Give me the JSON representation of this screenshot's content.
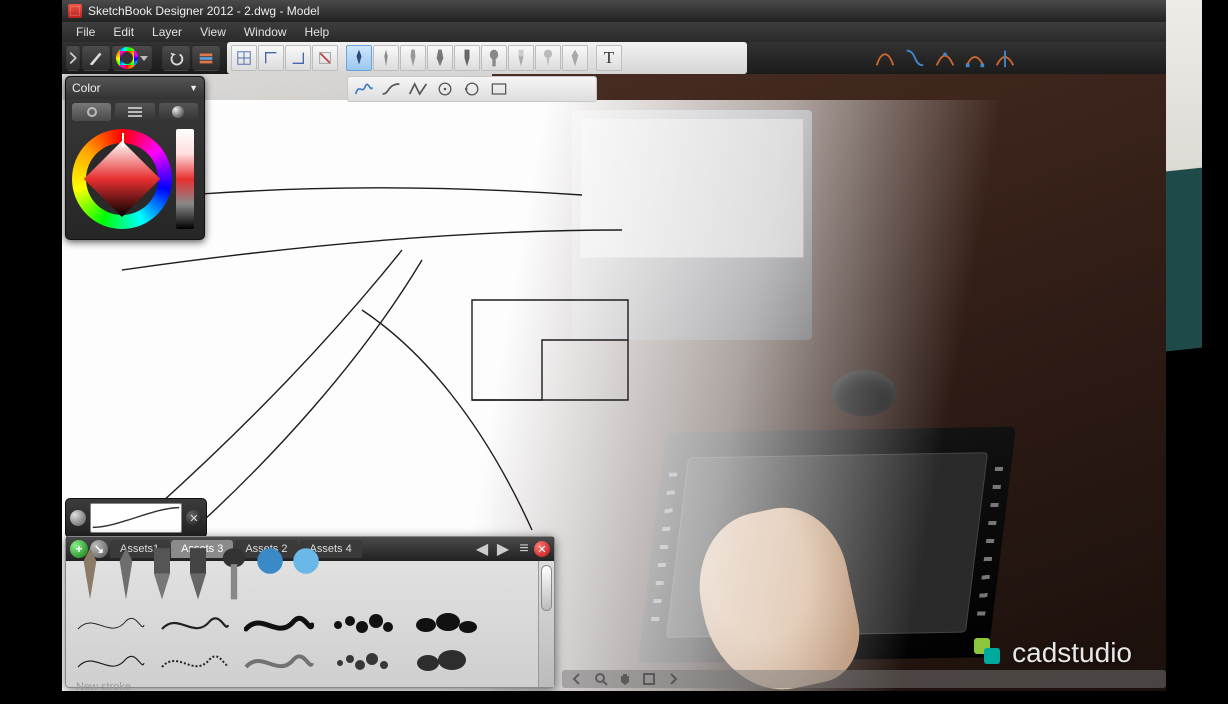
{
  "titlebar": {
    "title": "SketchBook Designer 2012 - 2.dwg - Model"
  },
  "menubar": {
    "items": [
      "File",
      "Edit",
      "Layer",
      "View",
      "Window",
      "Help"
    ]
  },
  "color_panel": {
    "title": "Color"
  },
  "toolbar1_icons": [
    "collapse-handle",
    "brush",
    "color-ring-dropdown",
    "",
    "undo",
    "redo-stripes",
    "",
    "snap-grid",
    "snap-perp",
    "snap-corner",
    "snap-off",
    "pen",
    "pen2",
    "marker",
    "marker2",
    "marker3",
    "airbrush",
    "pencil",
    "",
    "text",
    "",
    "curve-red",
    "curve-cyan",
    "curve-join",
    "curve-edit",
    "curve-split"
  ],
  "light_tools": [
    "pen-blue",
    "pen-thin",
    "pen-mid",
    "nib",
    "nib2",
    "chisel",
    "chisel2",
    "hilite",
    "round"
  ],
  "curve_shapes": [
    "freehand",
    "wave-s",
    "wave-n",
    "ellipse-center",
    "ellipse-3pt",
    "rect"
  ],
  "assets": {
    "tabs": [
      "Assets1",
      "Assets 3",
      "Assets 2",
      "Assets 4"
    ],
    "active_tab_index": 1,
    "footer": "New stroke"
  },
  "watermark": {
    "text": "cadstudio"
  }
}
